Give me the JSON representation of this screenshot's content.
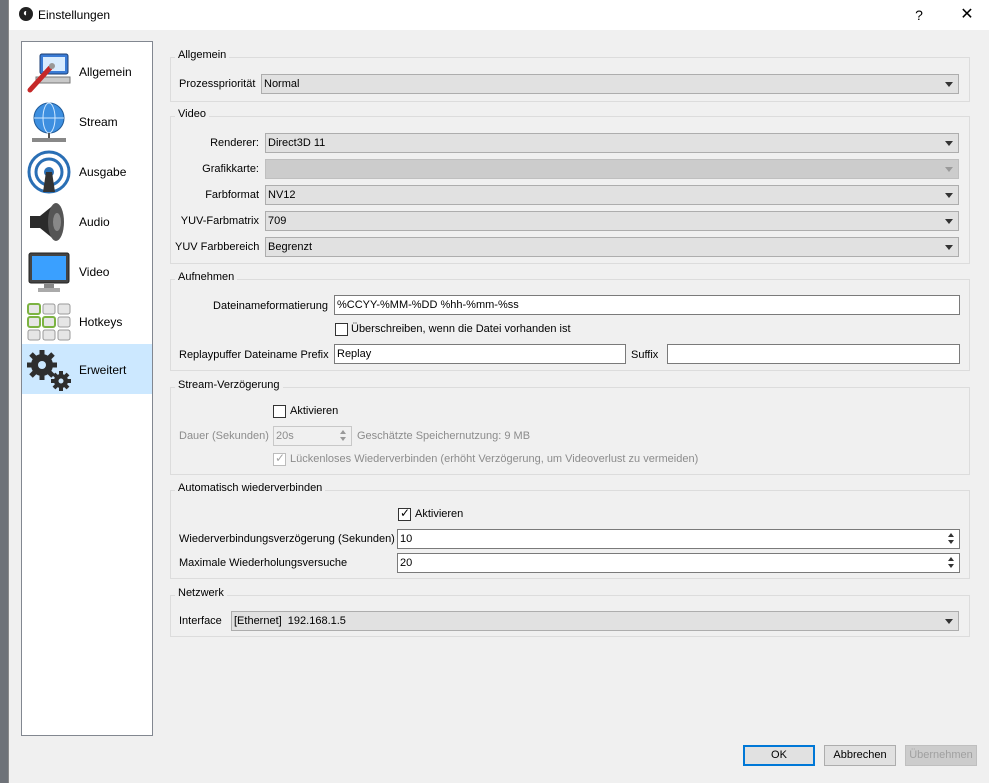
{
  "window": {
    "title": "Einstellungen",
    "help": "?",
    "close": "✕"
  },
  "sidebar": {
    "items": [
      {
        "label": "Allgemein",
        "icon": "general-icon"
      },
      {
        "label": "Stream",
        "icon": "stream-icon"
      },
      {
        "label": "Ausgabe",
        "icon": "output-icon"
      },
      {
        "label": "Audio",
        "icon": "audio-icon"
      },
      {
        "label": "Video",
        "icon": "video-icon"
      },
      {
        "label": "Hotkeys",
        "icon": "hotkeys-icon"
      },
      {
        "label": "Erweitert",
        "icon": "gears-icon",
        "active": true
      }
    ]
  },
  "general": {
    "title": "Allgemein",
    "priority_label": "Prozesspriorität",
    "priority_value": "Normal"
  },
  "video": {
    "title": "Video",
    "renderer_label": "Renderer:",
    "renderer_value": "Direct3D 11",
    "gpu_label": "Grafikkarte:",
    "gpu_value": "",
    "colorformat_label": "Farbformat",
    "colorformat_value": "NV12",
    "yuvmatrix_label": "YUV-Farbmatrix",
    "yuvmatrix_value": "709",
    "yuvrange_label": "YUV Farbbereich",
    "yuvrange_value": "Begrenzt"
  },
  "recording": {
    "title": "Aufnehmen",
    "filename_label": "Dateinameformatierung",
    "filename_value": "%CCYY-%MM-%DD %hh-%mm-%ss",
    "overwrite_label": "Überschreiben, wenn die Datei vorhanden ist",
    "overwrite_checked": false,
    "replay_prefix_label": "Replaypuffer Dateiname Prefix",
    "replay_prefix_value": "Replay",
    "suffix_label": "Suffix",
    "suffix_value": ""
  },
  "stream_delay": {
    "title": "Stream-Verzögerung",
    "enable_label": "Aktivieren",
    "enable_checked": false,
    "duration_label": "Dauer (Sekunden)",
    "duration_value": "20s",
    "memory_text": "Geschätzte Speichernutzung: 9 MB",
    "preserve_label": "Lückenloses Wiederverbinden (erhöht Verzögerung, um Videoverlust zu vermeiden)",
    "preserve_checked": true
  },
  "reconnect": {
    "title": "Automatisch wiederverbinden",
    "enable_label": "Aktivieren",
    "enable_checked": true,
    "delay_label": "Wiederverbindungsverzögerung (Sekunden)",
    "delay_value": "10",
    "retries_label": "Maximale Wiederholungsversuche",
    "retries_value": "20"
  },
  "network": {
    "title": "Netzwerk",
    "interface_label": "Interface",
    "interface_value": "[Ethernet]  192.168.1.5"
  },
  "buttons": {
    "ok": "OK",
    "cancel": "Abbrechen",
    "apply": "Übernehmen"
  },
  "colors": {
    "accent": "#0078d7",
    "selection": "#cce8ff",
    "window_bg": "#f0f0f0"
  }
}
